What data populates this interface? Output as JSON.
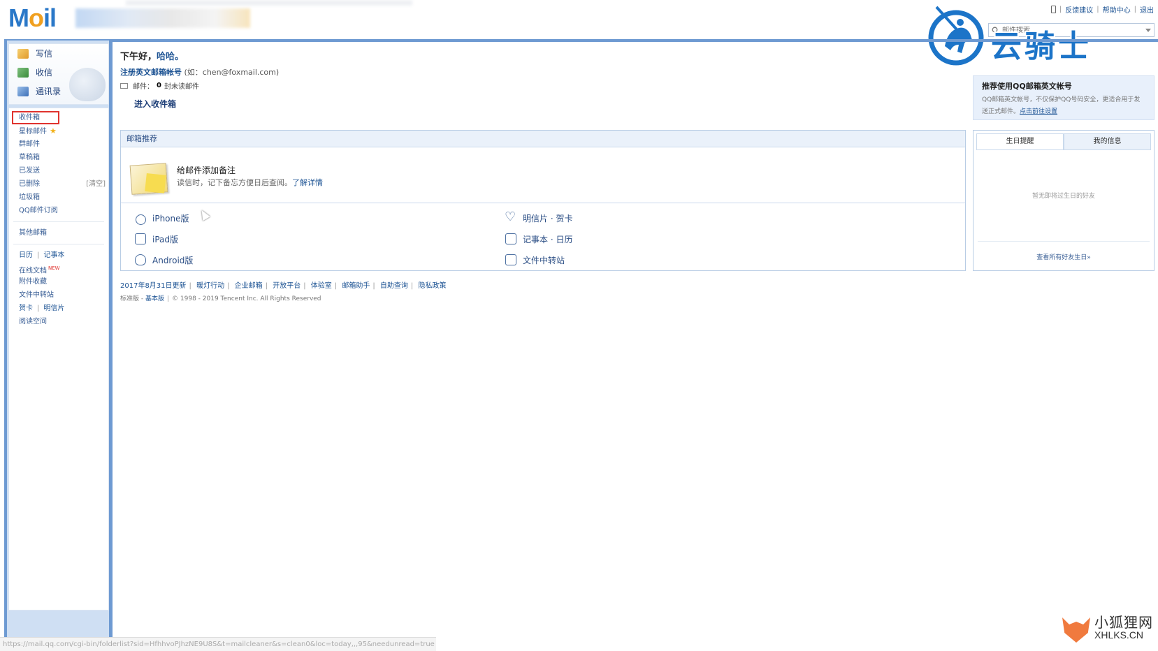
{
  "brand": {
    "logo_text_m": "M",
    "logo_text_o": "o",
    "logo_text_il": "il"
  },
  "top_links": {
    "feedback": "反馈建议",
    "help": "帮助中心",
    "logout": "退出"
  },
  "search": {
    "placeholder": "邮件搜索..."
  },
  "watermark_logo": {
    "text": "云骑士"
  },
  "sidebar": {
    "quick": {
      "write": "写信",
      "receive": "收信",
      "contacts": "通讯录"
    },
    "folders": [
      {
        "label": "收件箱"
      },
      {
        "label": "星标邮件"
      },
      {
        "label": "群邮件"
      },
      {
        "label": "草稿箱"
      },
      {
        "label": "已发送"
      },
      {
        "label": "已删除",
        "action": "[清空]"
      },
      {
        "label": "垃圾箱"
      },
      {
        "label": "QQ邮件订阅"
      }
    ],
    "other_mailbox": "其他邮箱",
    "tools": {
      "calendar": "日历",
      "notebook": "记事本",
      "online_docs": "在线文档",
      "new_tag": "NEW",
      "attachments": "附件收藏",
      "file_transfer": "文件中转站",
      "greeting_card": "贺卡",
      "postcard": "明信片",
      "reading": "阅读空间"
    }
  },
  "main": {
    "greeting_prefix": "下午好，",
    "greeting_name": "哈哈。",
    "register_link": "注册英文邮箱帐号",
    "register_hint": "(如：chen@foxmail.com)",
    "mail_label": "邮件：",
    "unread_count": "0",
    "unread_suffix": "封未读邮件",
    "enter_inbox": "进入收件箱"
  },
  "recommend": {
    "header": "邮箱推荐",
    "note_title": "给邮件添加备注",
    "note_desc": "读信时，记下备忘方便日后查阅。",
    "note_link": "了解详情",
    "apps": [
      {
        "label": "iPhone版",
        "icon": "apple-icon"
      },
      {
        "label": "明信片 · 贺卡",
        "icon": "heart-icon"
      },
      {
        "label": "iPad版",
        "icon": "tablet-icon"
      },
      {
        "label": "记事本 · 日历",
        "icon": "calendar-icon"
      },
      {
        "label": "Android版",
        "icon": "android-icon"
      },
      {
        "label": "文件中转站",
        "icon": "transfer-icon"
      }
    ]
  },
  "footer": {
    "links": [
      "2017年8月31日更新",
      "暖灯行动",
      "企业邮箱",
      "开放平台",
      "体验室",
      "邮箱助手",
      "自助查询",
      "隐私政策"
    ],
    "version_prefix": "标准版 - ",
    "version_link": "基本版",
    "copyright": "© 1998 - 2019 Tencent Inc. All Rights Reserved"
  },
  "promo": {
    "title": "推荐使用QQ邮箱英文帐号",
    "desc": "QQ邮箱英文帐号，不仅保护QQ号码安全，更适合用于发送正式邮件。",
    "link": "点击前往设置"
  },
  "birthday": {
    "tab_birthday": "生日提醒",
    "tab_myinfo": "我的信息",
    "empty": "暂无即将过生日的好友",
    "view_all": "查看所有好友生日»"
  },
  "statusbar": {
    "url": "https://mail.qq.com/cgi-bin/folderlist?sid=HfhhvoPJhzNE9U8S&t=mailcleaner&s=clean0&loc=today,,,95&needunread=true"
  },
  "fox_watermark": {
    "cn": "小狐狸网",
    "en": "XHLKS.CN"
  },
  "colors": {
    "frame_blue": "#6e9ad2",
    "link_blue": "#1e5494",
    "highlight_red": "#e0332e"
  }
}
